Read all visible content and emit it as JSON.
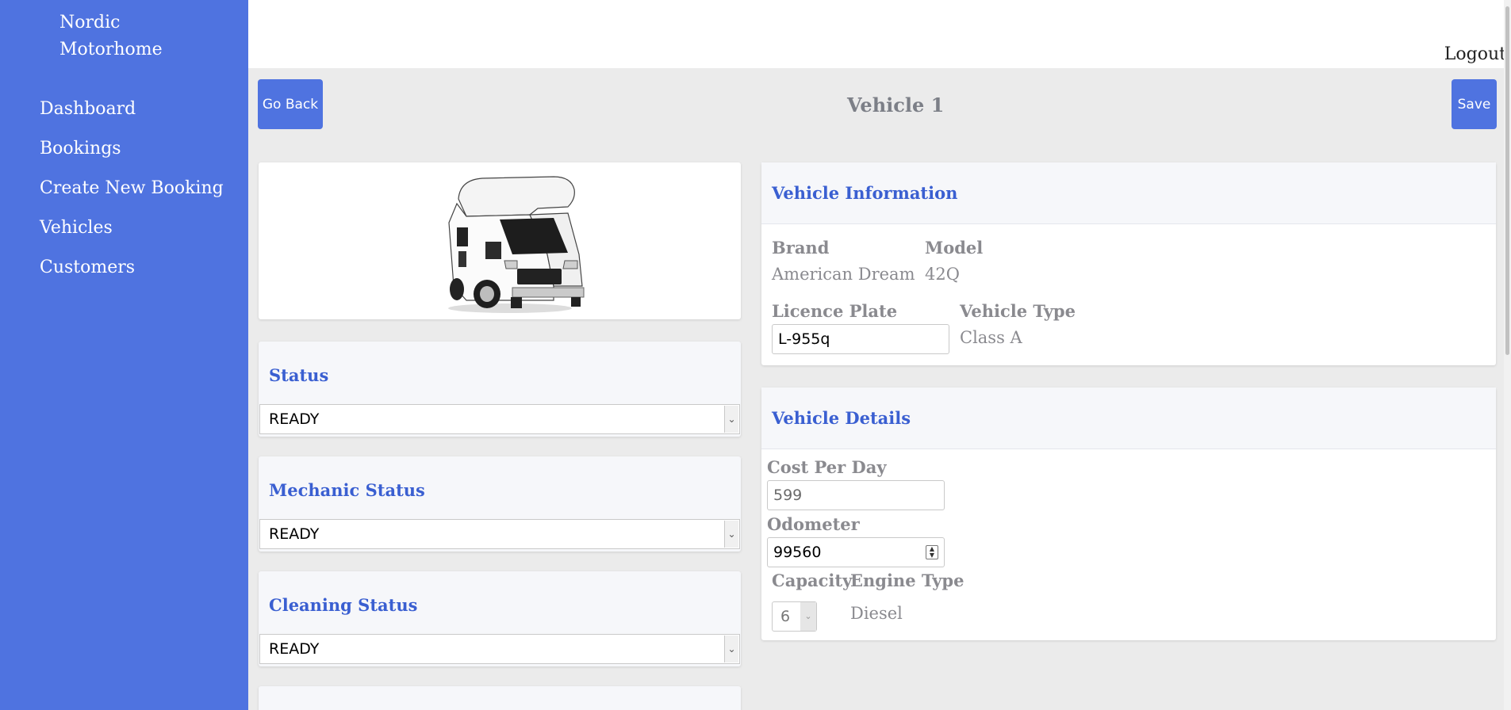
{
  "sidebar": {
    "brand_line1": "Nordic",
    "brand_line2": "Motorhome",
    "items": [
      {
        "label": "Dashboard"
      },
      {
        "label": "Bookings"
      },
      {
        "label": "Create New Booking"
      },
      {
        "label": "Vehicles"
      },
      {
        "label": "Customers"
      }
    ]
  },
  "topbar": {
    "logout_label": "Logout"
  },
  "actions": {
    "back_label": "Go Back",
    "save_label": "Save",
    "page_title": "Vehicle 1"
  },
  "status_cards": [
    {
      "title": "Status",
      "value": "READY"
    },
    {
      "title": "Mechanic Status",
      "value": "READY"
    },
    {
      "title": "Cleaning Status",
      "value": "READY"
    }
  ],
  "vehicle_information": {
    "title": "Vehicle Information",
    "brand_label": "Brand",
    "brand_value": "American Dream",
    "model_label": "Model",
    "model_value": "42Q",
    "plate_label": "Licence Plate",
    "plate_value": "L-955q",
    "type_label": "Vehicle Type",
    "type_value": "Class A"
  },
  "vehicle_details": {
    "title": "Vehicle Details",
    "cost_label": "Cost Per Day",
    "cost_value": "599",
    "odometer_label": "Odometer",
    "odometer_value": "99560",
    "capacity_label": "Capacity",
    "capacity_value": "6",
    "engine_label": "Engine Type",
    "engine_value": "Diesel"
  },
  "colors": {
    "accent": "#4f73e0",
    "heading": "#3a5fd1",
    "muted": "#8a8a8f",
    "background": "#ebebeb"
  }
}
